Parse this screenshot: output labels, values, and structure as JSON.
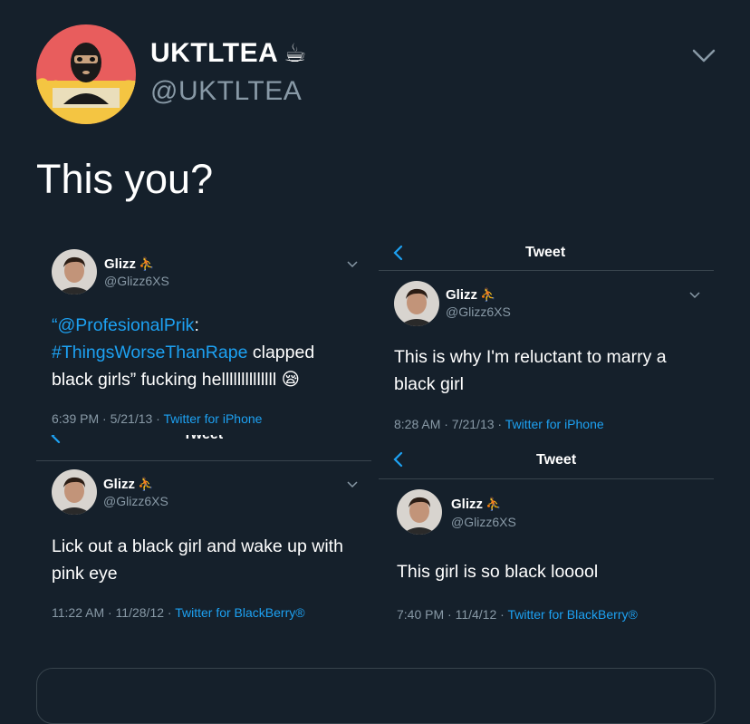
{
  "header": {
    "display_name": "UKTLTEA",
    "name_emoji": "☕",
    "handle": "@UKTLTEA"
  },
  "tweet": {
    "text": "This you?"
  },
  "screenshots": [
    {
      "name": "Glizz",
      "name_emoji": "⛹",
      "handle": "@Glizz6XS",
      "mention": "“@ProfesionalPrik",
      "after_mention": ":",
      "hashtag": "#ThingsWorseThanRape",
      "body_rest": " clapped black girls” fucking hellllllllllllll 😪",
      "time": "6:39 PM · 5/21/13 · ",
      "source": "Twitter for iPhone"
    },
    {
      "nav_title": "Tweet",
      "name": "Glizz",
      "name_emoji": "⛹",
      "handle": "@Glizz6XS",
      "body": "This is why I'm reluctant to marry a black girl",
      "time": "8:28 AM · 7/21/13 · ",
      "source": "Twitter for iPhone"
    },
    {
      "nav_title": "Tweet",
      "name": "Glizz",
      "name_emoji": "⛹",
      "handle": "@Glizz6XS",
      "body": "Lick out a black girl and wake up with pink eye",
      "time": "11:22 AM · 11/28/12 · ",
      "source": "Twitter for BlackBerry®"
    },
    {
      "nav_title": "Tweet",
      "name": "Glizz",
      "name_emoji": "⛹",
      "handle": "@Glizz6XS",
      "body": "This girl is so black looool",
      "time": "7:40 PM · 11/4/12 · ",
      "source": "Twitter for BlackBerry®"
    }
  ],
  "colors": {
    "background": "#15202b",
    "text": "#ffffff",
    "secondary_text": "#8899a6",
    "accent": "#1da1f2",
    "divider": "#38444d"
  }
}
